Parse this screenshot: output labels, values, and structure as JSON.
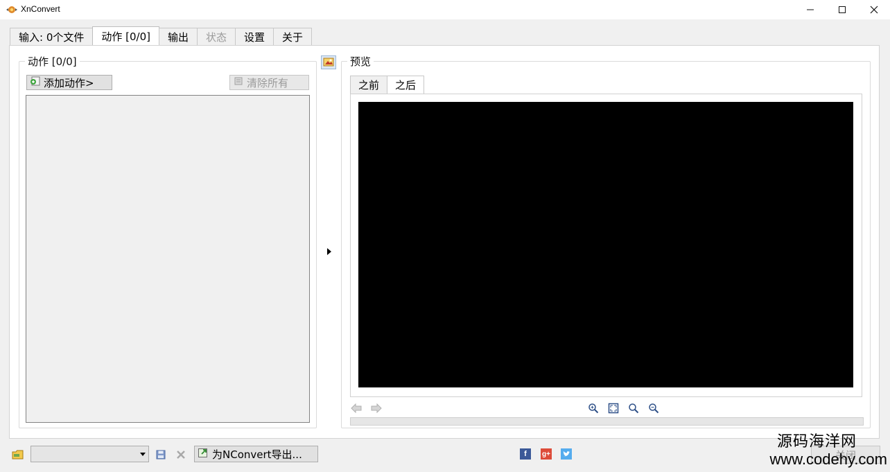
{
  "window": {
    "title": "XnConvert",
    "icon": "xnconvert-logo-icon"
  },
  "tabs": [
    {
      "label": "输入:  0个文件",
      "state": "normal"
    },
    {
      "label": "动作 [0/0]",
      "state": "active"
    },
    {
      "label": "输出",
      "state": "normal"
    },
    {
      "label": "状态",
      "state": "disabled"
    },
    {
      "label": "设置",
      "state": "normal"
    },
    {
      "label": "关于",
      "state": "normal"
    }
  ],
  "actions": {
    "legend": "动作 [0/0]",
    "add_label": "添加动作>",
    "clear_label": "清除所有",
    "items": []
  },
  "preview": {
    "legend": "预览",
    "tabs": [
      {
        "label": "之前",
        "state": "normal"
      },
      {
        "label": "之后",
        "state": "active"
      }
    ],
    "canvas_color": "#000000"
  },
  "bottom": {
    "preset_value": "",
    "export_label": "为NConvert导出...",
    "close_label": "关闭"
  },
  "watermark": {
    "line1": "源码海洋网",
    "line2": "www.codehy.com"
  },
  "colors": {
    "facebook": "#3b5998",
    "google_plus": "#dd4b39",
    "twitter": "#55acee"
  }
}
